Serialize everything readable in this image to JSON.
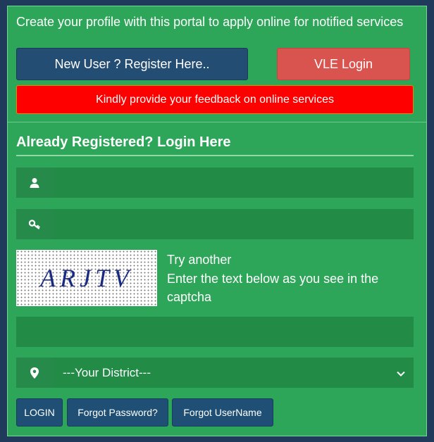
{
  "intro_text": "Create your profile with this portal to apply online for notified services",
  "buttons": {
    "register": "New User ? Register Here..",
    "vle_login": "VLE Login",
    "feedback": "Kindly provide your feedback on online services"
  },
  "login": {
    "title": "Already Registered? Login Here",
    "username_placeholder": "",
    "password_placeholder": "",
    "captcha_text": "ARJTV",
    "try_another": "Try another",
    "captcha_instructions": "Enter the text below as you see in the captcha",
    "captcha_placeholder": "",
    "district_selected": "---Your District---",
    "login_button": "LOGIN",
    "forgot_password": "Forgot Password?",
    "forgot_username": "Forgot UserName"
  },
  "colors": {
    "panel_bg": "#2ea659",
    "field_bg": "#228c47",
    "register_btn": "#234d73",
    "vle_btn": "#d9534f",
    "feedback_btn": "#ff0000"
  },
  "icons": {
    "username": "user-icon",
    "password": "key-icon",
    "district": "map-marker-icon",
    "dropdown": "chevron-down-icon"
  }
}
